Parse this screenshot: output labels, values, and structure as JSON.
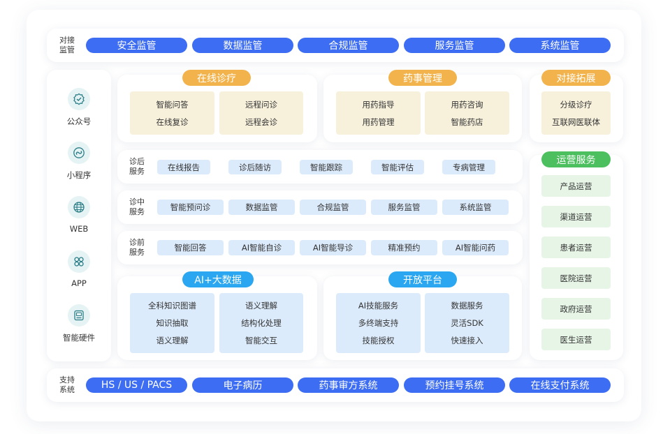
{
  "top_bar": {
    "label_line1": "对接",
    "label_line2": "监管",
    "items": [
      "安全监管",
      "数据监管",
      "合规监管",
      "服务监管",
      "系统监管"
    ]
  },
  "channels": [
    {
      "label": "公众号",
      "icon": "gear-check-icon"
    },
    {
      "label": "小程序",
      "icon": "mini-program-icon"
    },
    {
      "label": "WEB",
      "icon": "globe-icon"
    },
    {
      "label": "APP",
      "icon": "app-clover-icon"
    },
    {
      "label": "智能硬件",
      "icon": "device-icon"
    }
  ],
  "online_diagnosis": {
    "title": "在线诊疗",
    "left": [
      "智能问答",
      "在线复诊"
    ],
    "right": [
      "远程问诊",
      "远程会诊"
    ]
  },
  "pharmacy": {
    "title": "药事管理",
    "left": [
      "用药指导",
      "用药管理"
    ],
    "right": [
      "用药咨询",
      "智能药店"
    ]
  },
  "rows": [
    {
      "label_line1": "诊后",
      "label_line2": "服务",
      "items": [
        "在线报告",
        "诊后随访",
        "智能跟踪",
        "智能评估",
        "专病管理"
      ]
    },
    {
      "label_line1": "诊中",
      "label_line2": "服务",
      "items": [
        "智能预问诊",
        "数据监管",
        "合规监管",
        "服务监管",
        "系统监管"
      ]
    },
    {
      "label_line1": "诊前",
      "label_line2": "服务",
      "items": [
        "智能回答",
        "AI智能自诊",
        "AI智能导诊",
        "精准预约",
        "AI智能问药"
      ]
    }
  ],
  "ai_bigdata": {
    "title": "AI+大数据",
    "left": [
      "全科知识图谱",
      "知识抽取",
      "语义理解"
    ],
    "right": [
      "语义理解",
      "结构化处理",
      "智能交互"
    ]
  },
  "open_platform": {
    "title": "开放平台",
    "left": [
      "AI技能服务",
      "多终端支持",
      "技能授权"
    ],
    "right": [
      "数据服务",
      "灵活SDK",
      "快速接入"
    ]
  },
  "integration": {
    "title": "对接拓展",
    "items": [
      "分级诊疗",
      "互联网医联体"
    ]
  },
  "operations": {
    "title": "运营服务",
    "items": [
      "产品运营",
      "渠道运营",
      "患者运营",
      "医院运营",
      "政府运营",
      "医生运营"
    ]
  },
  "bottom_bar": {
    "label_line1": "支持",
    "label_line2": "系统",
    "items": [
      "HS / US / PACS",
      "电子病历",
      "药事审方系统",
      "预约挂号系统",
      "在线支付系统"
    ]
  },
  "colors": {
    "primary_blue": "#3d6df2",
    "orange": "#f3b34c",
    "cyan": "#2aa7f0",
    "green": "#4cbf5f",
    "cream": "#f7f1dc",
    "light_blue": "#dcebfb",
    "light_green": "#e6f5e6",
    "teal_circle": "#e5f3f4"
  }
}
